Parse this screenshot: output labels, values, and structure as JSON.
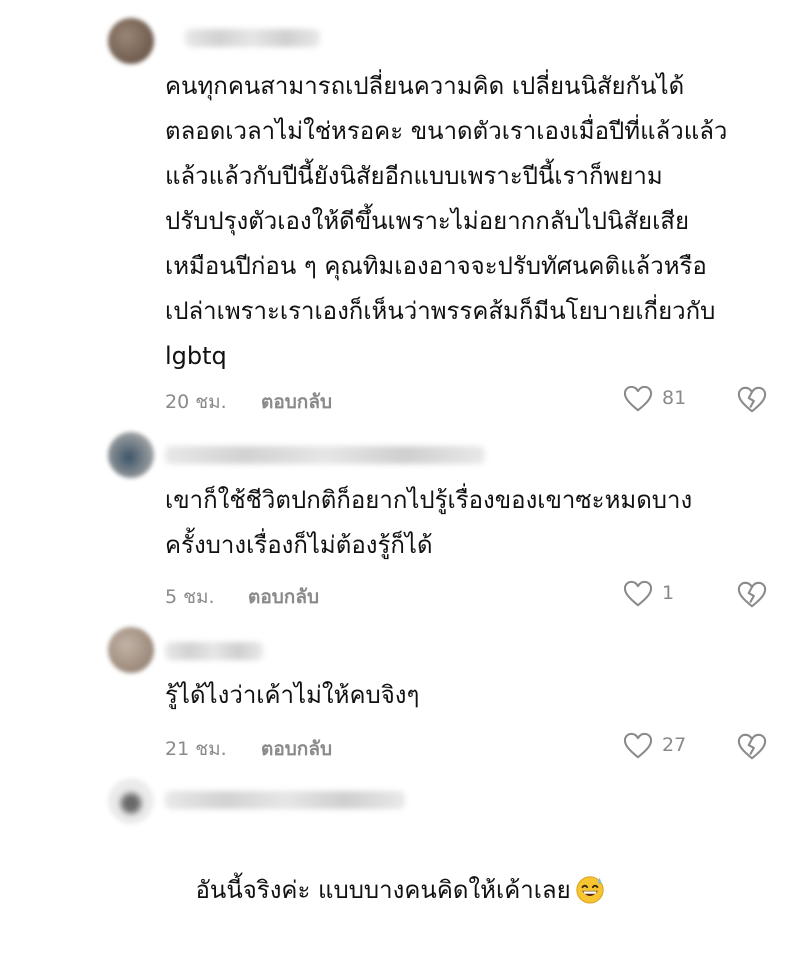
{
  "comments": [
    {
      "avatar_color": "#7d6a5c",
      "text": "คนทุกคนสามารถเปลี่ยนความคิด เปลี่ยนนิสัยกันได้\nตลอดเวลาไม่ใช่หรอคะ ขนาดตัวเราเองเมื่อปีที่แล้วแล้ว\nแล้วแล้วกับปีนี้ยังนิสัยอีกแบบเพราะปีนี้เราก็พยาม\nปรับปรุงตัวเองให้ดีขึ้นเพราะไม่อยากกลับไปนิสัยเสีย\nเหมือนปีก่อน ๆ คุณทิมเองอาจจะปรับทัศนคติแล้วหรือ\nเปล่าเพราะเราเองก็เห็นว่าพรรคส้มก็มีนโยบายเกี่ยวกับ\nlgbtq",
      "time": "20 ชม.",
      "reply_label": "ตอบกลับ",
      "likes": "81"
    },
    {
      "avatar_color": "#5d6b78",
      "text": "เขาก็ใช้ชีวิตปกติก็อยากไปรู้เรื่องของเขาซะหมดบาง\nครั้งบางเรื่องก็ไม่ต้องรู้ก็ได้",
      "time": "5 ชม.",
      "reply_label": "ตอบกลับ",
      "likes": "1"
    },
    {
      "avatar_color": "#a08f82",
      "text": "รู้ได้ไงว่าเค้าไม่ให้คบจิงๆ",
      "time": "21 ชม.",
      "reply_label": "ตอบกลับ",
      "likes": "27"
    },
    {
      "avatar_color": "#b8b8b8",
      "text": "อันนี้จริงค่ะ แบบบางคนคิดให้เค้าเลย",
      "emoji": "grinning-sweat-emoji"
    }
  ]
}
